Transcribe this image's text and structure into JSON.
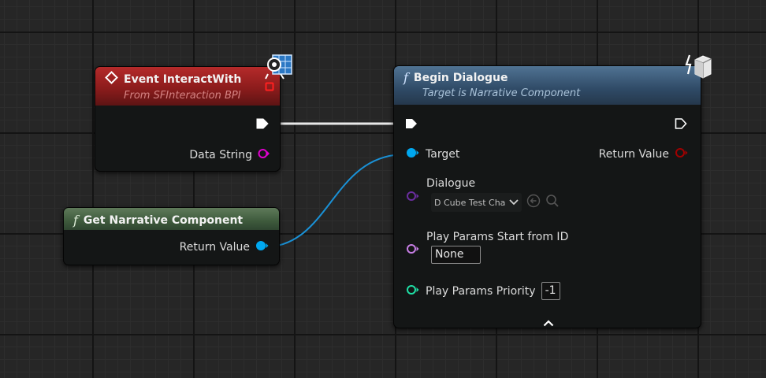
{
  "event_node": {
    "title": "Event InteractWith",
    "subtitle": "From SFInteraction BPI",
    "pin_data_string": "Data String"
  },
  "get_node": {
    "title": "Get Narrative Component",
    "pin_return": "Return Value"
  },
  "begin_node": {
    "title": "Begin Dialogue",
    "subtitle": "Target is Narrative Component",
    "pin_target": "Target",
    "pin_return": "Return Value",
    "pin_dialogue": "Dialogue",
    "dialogue_value": "D Cube Test Cha",
    "pin_start_id": "Play Params Start from ID",
    "start_id_value": "None",
    "pin_priority": "Play Params Priority",
    "priority_value": "-1"
  },
  "icons": {
    "event": "diamond-event-icon",
    "function": "function-f-icon",
    "interface": "interface-gear-icon",
    "cube": "cube-icon",
    "browse": "browse-arrow-icon",
    "search": "search-icon",
    "collapse": "chevron-up-icon"
  },
  "colors": {
    "exec": "#ffffff",
    "object_pin": "#00a8f0",
    "string_pin": "#e000d0",
    "name_pin": "#c77ee5",
    "dialogue_pin": "#6b2ea0",
    "int_pin": "#1fe0a6",
    "return_pin": "#a00000",
    "event_header": "#a52222",
    "function_header": "#3d5d7c",
    "pure_header": "#4e6a4a"
  }
}
